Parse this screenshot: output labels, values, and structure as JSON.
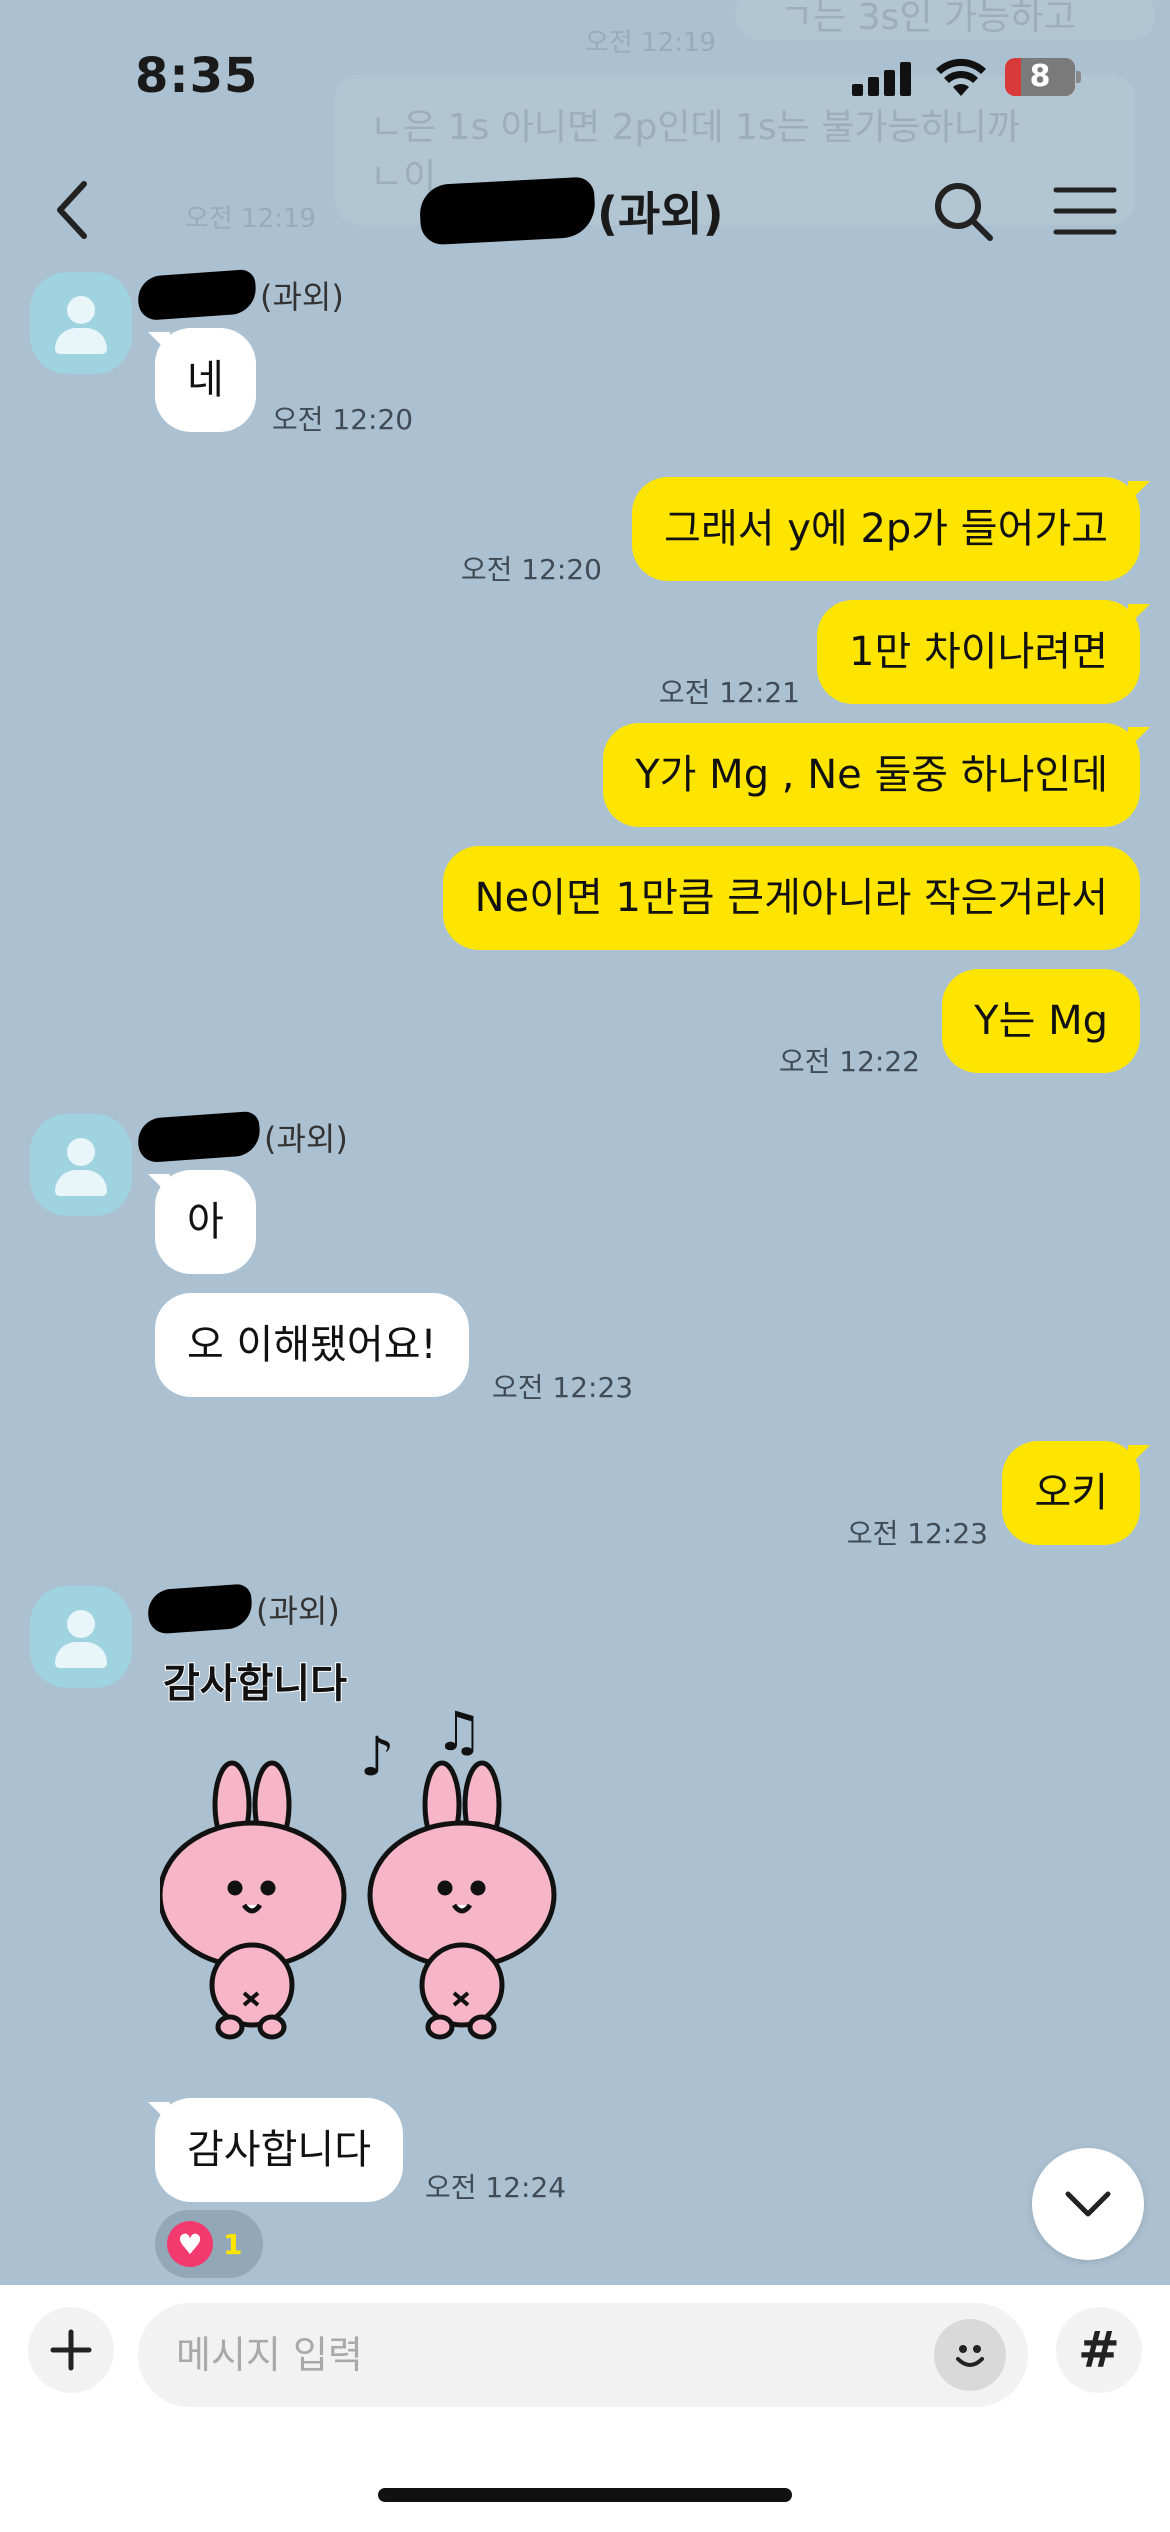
{
  "status_bar": {
    "time": "8:35",
    "battery": "8"
  },
  "header": {
    "title_suffix": "(과외)"
  },
  "ghost_lines": [
    "ㄱ는 3s인 가능하고",
    "오전 12:19",
    "ㄴ은 1s 아니면 2p인데 1s는 불가능하니까",
    "ㄴ이",
    "오전 12:19"
  ],
  "messages": {
    "group1": {
      "sender": "(과외)",
      "bubbles": [
        "네"
      ],
      "time": "오전 12:20"
    },
    "out1": {
      "bubbles": [
        "그래서 y에 2p가 들어가고"
      ],
      "time": "오전 12:20"
    },
    "out2": {
      "bubbles": [
        "1만 차이나려면"
      ],
      "time": "오전 12:21"
    },
    "out3": {
      "bubbles": [
        "Y가 Mg , Ne 둘중 하나인데",
        "Ne이면 1만큼 큰게아니라 작은거라서",
        "Y는 Mg"
      ],
      "time": "오전 12:22"
    },
    "group2": {
      "sender": "(과외)",
      "bubbles": [
        "아",
        "오 이해됐어요!"
      ],
      "time": "오전 12:23"
    },
    "out4": {
      "bubbles": [
        "오키"
      ],
      "time": "오전 12:23"
    },
    "group3": {
      "sender": "(과외)",
      "sticker_text": "감사합니다",
      "bubbles": [
        "감사합니다"
      ],
      "time": "오전 12:24",
      "reaction_count": "1"
    }
  },
  "input": {
    "placeholder": "메시지 입력"
  },
  "icons": {
    "back": "chevron-left-icon",
    "search": "search-icon",
    "menu": "hamburger-menu-icon",
    "plus": "plus-icon",
    "emoji": "emoji-icon",
    "hash": "#",
    "scroll_down": "chevron-down-icon",
    "reaction": "heart-icon"
  },
  "colors": {
    "background": "#abc1d1",
    "outgoing_bubble": "#fee500",
    "incoming_bubble": "#ffffff",
    "reaction_heart": "#f33a6e"
  }
}
